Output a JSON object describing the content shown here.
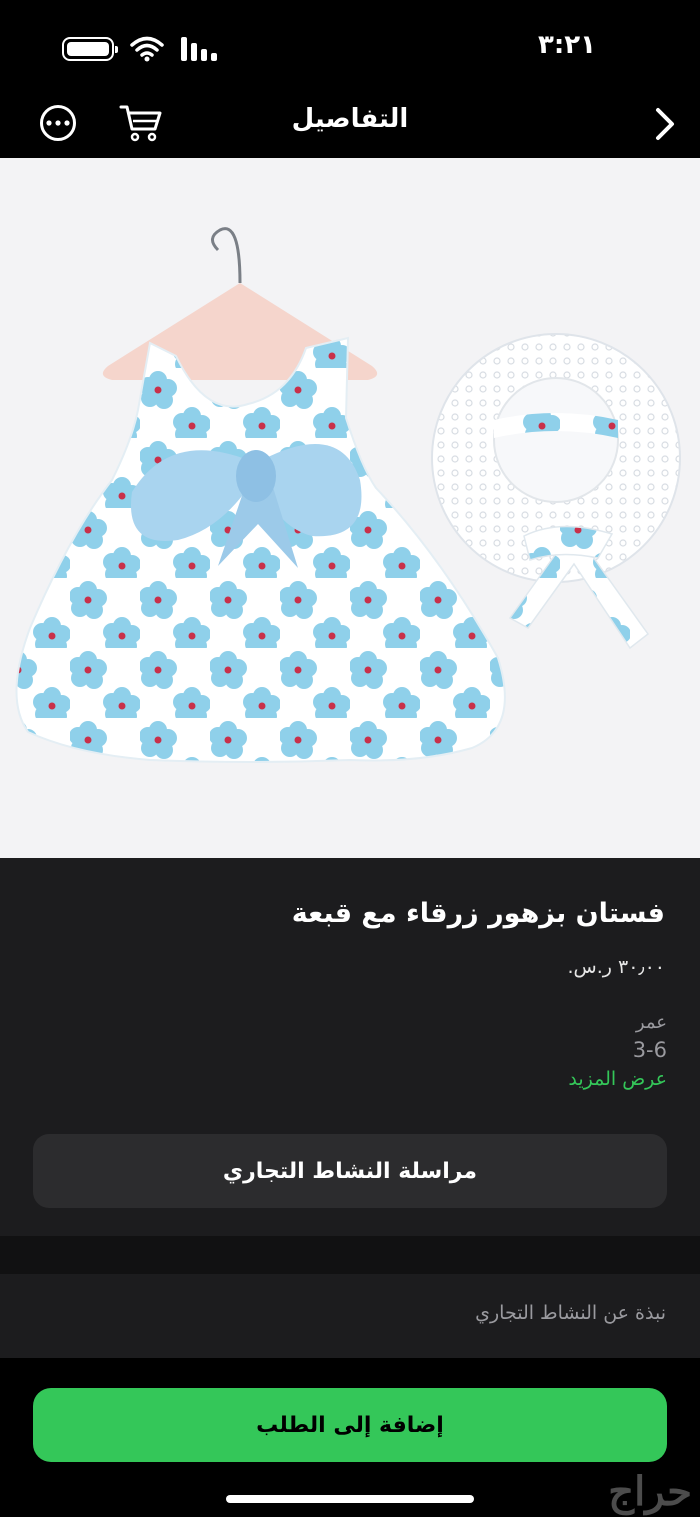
{
  "status_bar": {
    "time": "٣:٢١",
    "icons": [
      "battery-icon",
      "wifi-icon",
      "signal-icon"
    ]
  },
  "nav": {
    "title": "التفاصيل",
    "icons": [
      "more-icon",
      "cart-icon",
      "chevron-icon"
    ]
  },
  "product": {
    "title": "فستان بزهور زرقاء مع قبعة",
    "price": "٣٠٫٠٠ ر.س.",
    "attribute_label": "عمر",
    "attribute_value": "3-6",
    "show_more": "عرض المزيد"
  },
  "buttons": {
    "contact": "مراسلة النشاط التجاري",
    "add_to_order": "إضافة إلى الطلب"
  },
  "about": {
    "label": "نبذة عن النشاط التجاري"
  },
  "watermark": "حراج",
  "colors": {
    "accent": "#34c759",
    "background": "#000000",
    "surface": "#1c1c1e",
    "button_surface": "#2c2c2e",
    "dress_blue": "#8fd0ea"
  }
}
